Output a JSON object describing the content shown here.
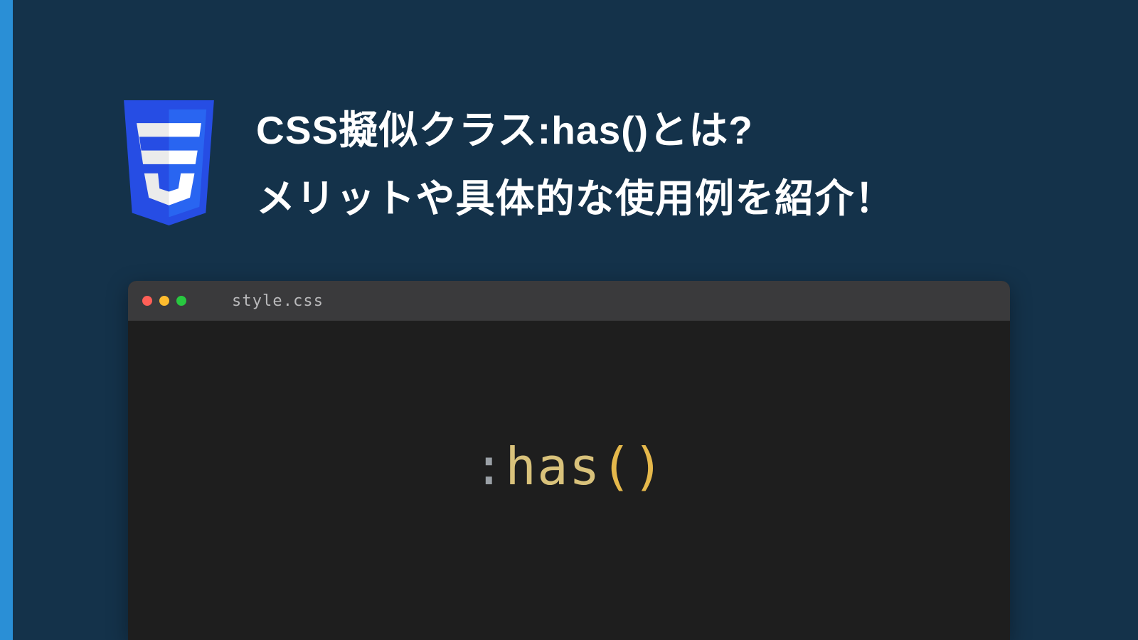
{
  "header": {
    "title_line1": "CSS擬似クラス:has()とは?",
    "title_line2": "メリットや具体的な使用例を紹介！",
    "logo_glyph": "3"
  },
  "editor": {
    "filename": "style.css",
    "code": {
      "colon": ":",
      "name": "has",
      "open": "(",
      "close": ")"
    }
  },
  "colors": {
    "accent": "#2a8fd6",
    "background": "#14324a",
    "editor_bg": "#1e1e1e",
    "titlebar": "#3a3a3c",
    "token_name": "#d9c27b",
    "token_paren": "#e5b84b",
    "token_colon": "#9aa0a6"
  }
}
